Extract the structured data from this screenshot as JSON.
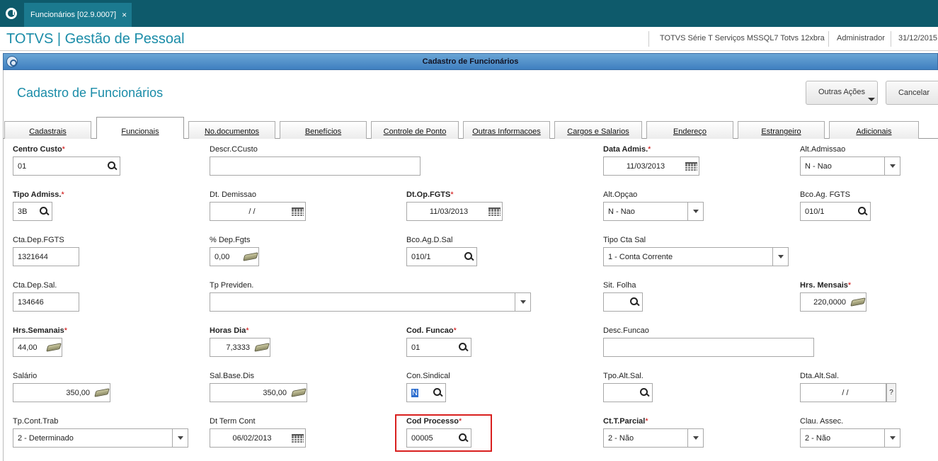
{
  "app_tab": {
    "label": "Funcionários [02.9.0007]",
    "close": "×"
  },
  "header": {
    "brand": "TOTVS | Gestão de Pessoal",
    "environment": "TOTVS Série T Serviços MSSQL7 Totvs 12xbra",
    "user": "Administrador",
    "date": "31/12/2015"
  },
  "dialog": {
    "window_title": "Cadastro de Funcionários",
    "page_title": "Cadastro de Funcionários",
    "buttons": {
      "other_actions": "Outras Ações",
      "cancel": "Cancelar"
    }
  },
  "tabs": [
    {
      "label": "Cadastrais"
    },
    {
      "label": "Funcionais"
    },
    {
      "label": "No.documentos"
    },
    {
      "label": "Benefícios"
    },
    {
      "label": "Controle de Ponto"
    },
    {
      "label": "Outras Informacoes"
    },
    {
      "label": "Cargos e Salarios"
    },
    {
      "label": "Endereço"
    },
    {
      "label": "Estrangeiro"
    },
    {
      "label": "Adicionais"
    }
  ],
  "active_tab": "Funcionais",
  "fields": {
    "centro_custo": {
      "label": "Centro Custo",
      "value": "01"
    },
    "descr_ccusto": {
      "label": "Descr.CCusto",
      "value": ""
    },
    "data_admis": {
      "label": "Data Admis.",
      "value": "11/03/2013"
    },
    "alt_admissao": {
      "label": "Alt.Admissao",
      "value": "N - Nao"
    },
    "tipo_admiss": {
      "label": "Tipo Admiss.",
      "value": "3B"
    },
    "dt_demissao": {
      "label": "Dt. Demissao",
      "value": "/ /"
    },
    "dt_op_fgts": {
      "label": "Dt.Op.FGTS",
      "value": "11/03/2013"
    },
    "alt_opcao": {
      "label": "Alt.Opçao",
      "value": "N - Nao"
    },
    "bco_ag_fgts": {
      "label": "Bco.Ag. FGTS",
      "value": "010/1"
    },
    "cta_dep_fgts": {
      "label": "Cta.Dep.FGTS",
      "value": "1321644"
    },
    "pct_dep_fgts": {
      "label": "% Dep.Fgts",
      "value": "0,00"
    },
    "bco_ag_d_sal": {
      "label": "Bco.Ag.D.Sal",
      "value": "010/1"
    },
    "tipo_cta_sal": {
      "label": "Tipo Cta Sal",
      "value": "1 - Conta Corrente"
    },
    "cta_dep_sal": {
      "label": "Cta.Dep.Sal.",
      "value": "134646"
    },
    "tp_previden": {
      "label": "Tp Previden.",
      "value": ""
    },
    "sit_folha": {
      "label": "Sit. Folha",
      "value": ""
    },
    "hrs_mensais": {
      "label": "Hrs. Mensais",
      "value": "220,0000"
    },
    "hrs_semanais": {
      "label": "Hrs.Semanais",
      "value": "44,00"
    },
    "horas_dia": {
      "label": "Horas Dia",
      "value": "7,3333"
    },
    "cod_funcao": {
      "label": "Cod. Funcao",
      "value": "01"
    },
    "desc_funcao": {
      "label": "Desc.Funcao",
      "value": ""
    },
    "salario": {
      "label": "Salário",
      "value": "350,00"
    },
    "sal_base_dis": {
      "label": "Sal.Base.Dis",
      "value": "350,00"
    },
    "con_sindical": {
      "label": "Con.Sindical",
      "value": "N"
    },
    "tpo_alt_sal": {
      "label": "Tpo.Alt.Sal.",
      "value": ""
    },
    "dta_alt_sal": {
      "label": "Dta.Alt.Sal.",
      "value": "/ /",
      "help": "?"
    },
    "tp_cont_trab": {
      "label": "Tp.Cont.Trab",
      "value": "2 - Determinado"
    },
    "dt_term_cont": {
      "label": "Dt Term Cont",
      "value": "06/02/2013"
    },
    "cod_processo": {
      "label": "Cod Processo",
      "value": "00005"
    },
    "ct_t_parcial": {
      "label": "Ct.T.Parcial",
      "value": "2 - Não"
    },
    "clau_assec": {
      "label": "Clau. Assec.",
      "value": "2 - Não"
    }
  },
  "required_marker": "*",
  "colors": {
    "teal_bar": "#0e5a6b",
    "brand": "#1a8ca8",
    "required": "#cc0000",
    "highlight": "#d9201f"
  }
}
